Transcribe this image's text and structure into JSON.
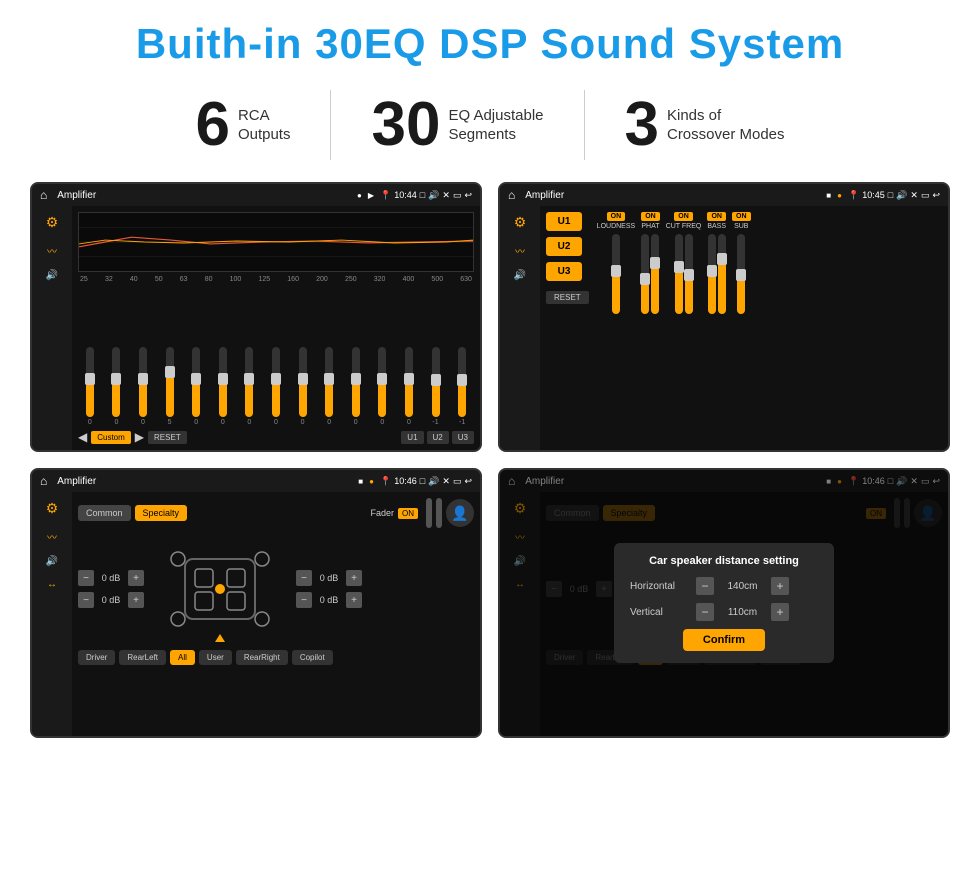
{
  "header": {
    "title": "Buith-in 30EQ DSP Sound System"
  },
  "stats": [
    {
      "number": "6",
      "text_line1": "RCA",
      "text_line2": "Outputs"
    },
    {
      "number": "30",
      "text_line1": "EQ Adjustable",
      "text_line2": "Segments"
    },
    {
      "number": "3",
      "text_line1": "Kinds of",
      "text_line2": "Crossover Modes"
    }
  ],
  "screens": {
    "eq": {
      "app_name": "Amplifier",
      "time": "10:44",
      "freq_labels": [
        "25",
        "32",
        "40",
        "50",
        "63",
        "80",
        "100",
        "125",
        "160",
        "200",
        "250",
        "320",
        "400",
        "500",
        "630"
      ],
      "buttons": [
        "Custom",
        "RESET",
        "U1",
        "U2",
        "U3"
      ],
      "values": [
        "0",
        "0",
        "0",
        "5",
        "0",
        "0",
        "0",
        "0",
        "0",
        "0",
        "0",
        "0",
        "0",
        "-1",
        "0",
        "-1"
      ]
    },
    "crossover": {
      "app_name": "Amplifier",
      "time": "10:45",
      "u_buttons": [
        "U1",
        "U2",
        "U3"
      ],
      "columns": [
        {
          "on": true,
          "label": "LOUDNESS"
        },
        {
          "on": true,
          "label": "PHAT"
        },
        {
          "on": true,
          "label": "CUT FREQ"
        },
        {
          "on": true,
          "label": "BASS"
        },
        {
          "on": true,
          "label": "SUB"
        }
      ],
      "reset_label": "RESET"
    },
    "fader": {
      "app_name": "Amplifier",
      "time": "10:46",
      "tabs": [
        "Common",
        "Specialty"
      ],
      "fader_label": "Fader",
      "on_label": "ON",
      "db_values": [
        "0 dB",
        "0 dB",
        "0 dB",
        "0 dB"
      ],
      "bottom_buttons": [
        "Driver",
        "RearLeft",
        "All",
        "User",
        "RearRight",
        "Copilot"
      ]
    },
    "dialog": {
      "app_name": "Amplifier",
      "time": "10:46",
      "tabs": [
        "Common",
        "Specialty"
      ],
      "dialog_title": "Car speaker distance setting",
      "horizontal_label": "Horizontal",
      "horizontal_value": "140cm",
      "vertical_label": "Vertical",
      "vertical_value": "110cm",
      "confirm_label": "Confirm",
      "db_values": [
        "0 dB",
        "0 dB"
      ],
      "bottom_buttons": [
        "Driver",
        "RearLeft",
        "All",
        "User",
        "RearRight",
        "Copilot"
      ]
    }
  }
}
